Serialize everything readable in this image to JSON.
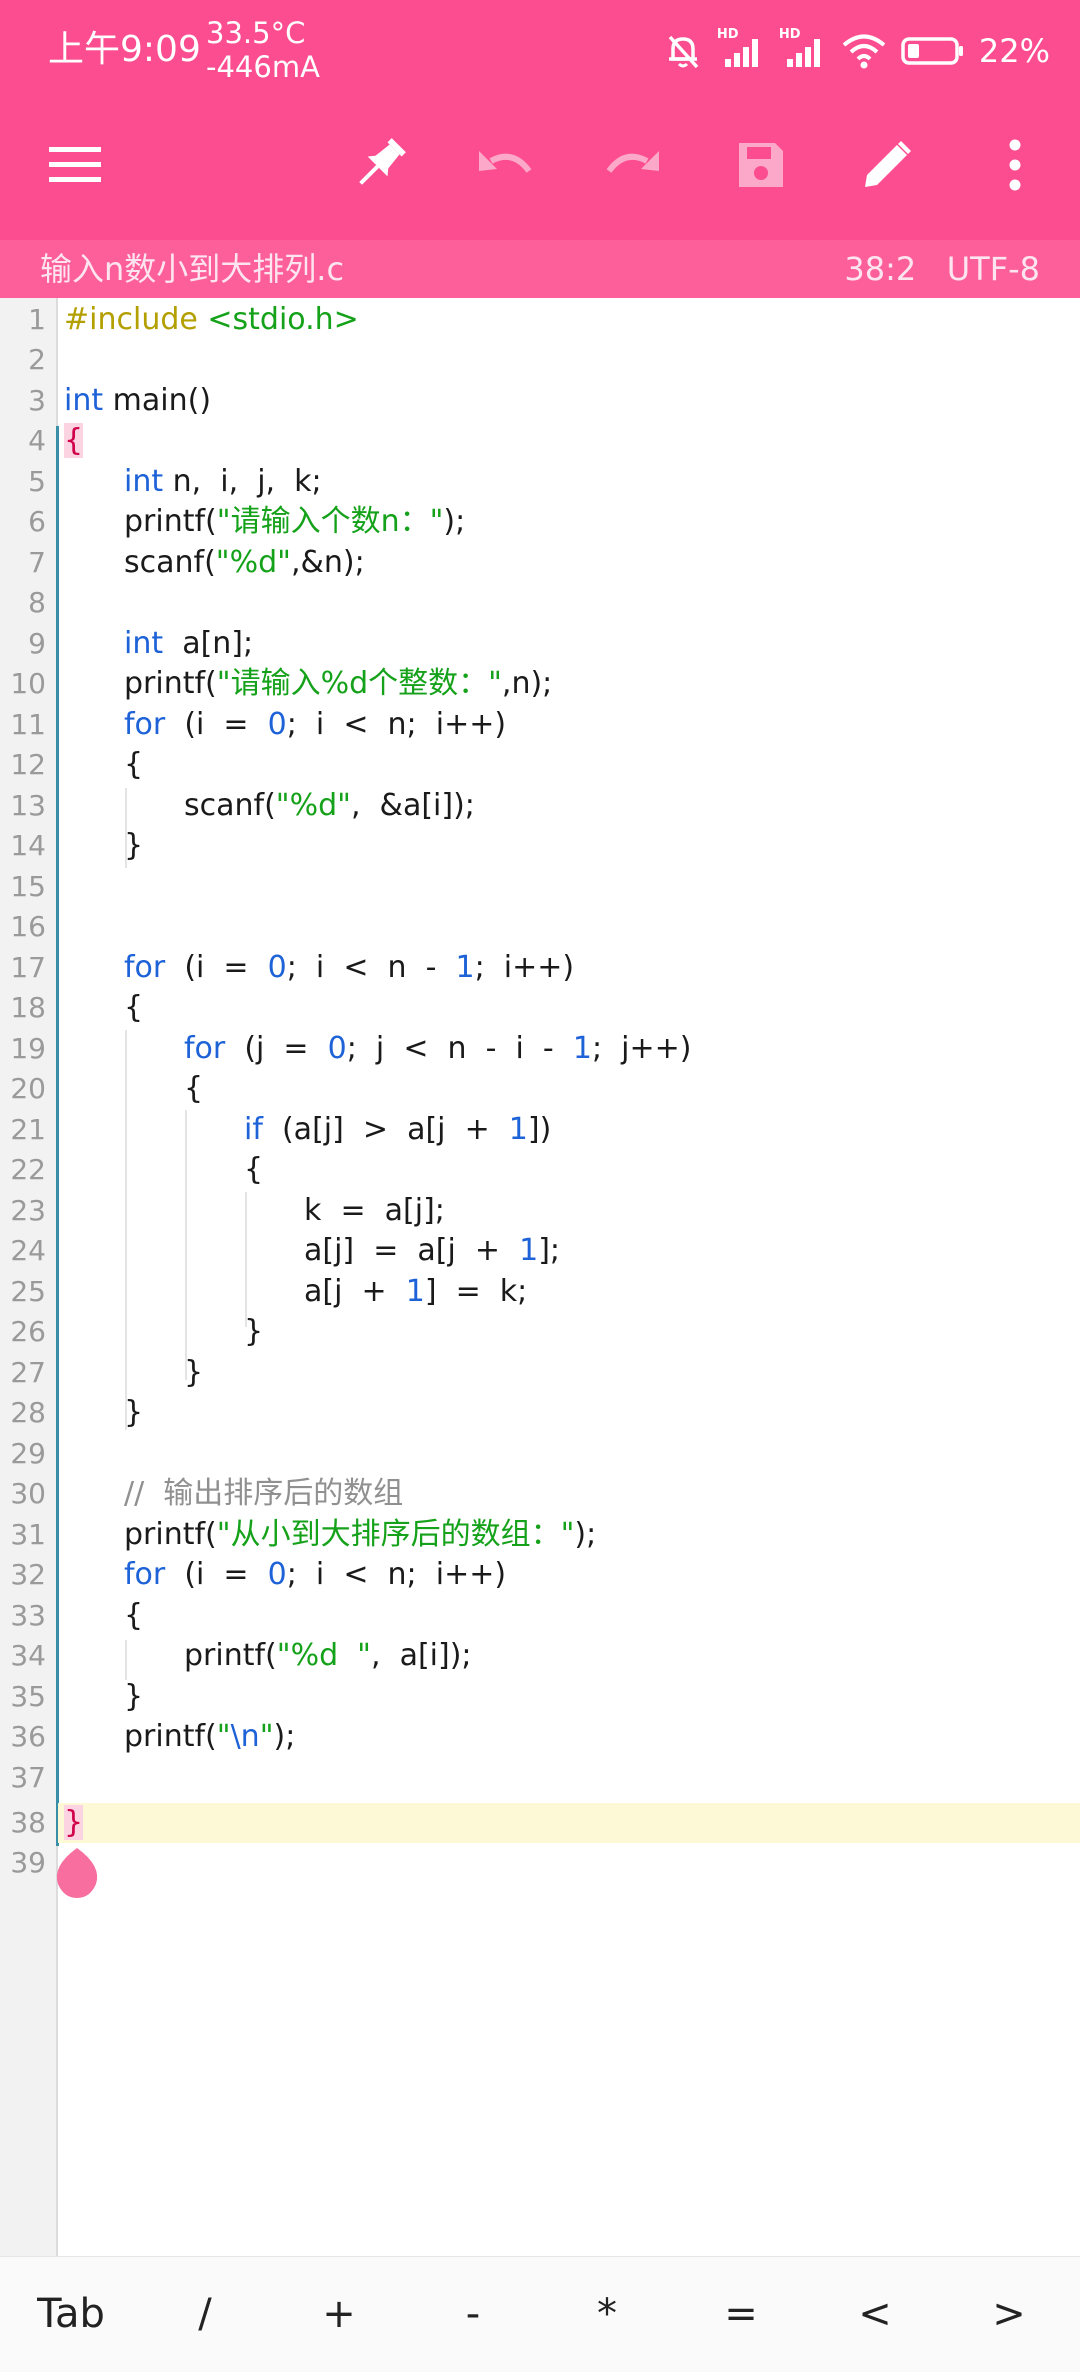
{
  "status_bar": {
    "time": "上午9:09",
    "temperature": "33.5°C",
    "current": "-446mA",
    "hd1": "HD",
    "hd2": "HD",
    "battery_percent": "22%"
  },
  "toolbar": {
    "icons": [
      "menu-icon",
      "pin-icon",
      "undo-icon",
      "redo-icon",
      "save-icon",
      "edit-icon",
      "more-icon"
    ],
    "accent": "#fb4d8f"
  },
  "file": {
    "name": "输入n数小到大排列.c",
    "cursor": "38:2",
    "encoding": "UTF-8"
  },
  "editor": {
    "line_numbers": [
      "1",
      "2",
      "3",
      "4",
      "5",
      "6",
      "7",
      "8",
      "9",
      "10",
      "11",
      "12",
      "13",
      "14",
      "15",
      "16",
      "17",
      "18",
      "19",
      "20",
      "21",
      "22",
      "23",
      "24",
      "25",
      "26",
      "27",
      "28",
      "29",
      "30",
      "31",
      "32",
      "33",
      "34",
      "35",
      "36",
      "37",
      "38",
      "39"
    ],
    "lines": [
      [
        "#include",
        " ",
        "<stdio.h>"
      ],
      [],
      [
        "int",
        " main()"
      ],
      [
        "{"
      ],
      [
        "int",
        " n,  i,  j,  k;"
      ],
      [
        "printf(",
        "\"请输入个数n：\"",
        ");"
      ],
      [
        "scanf(",
        "\"%d\"",
        ",&n);"
      ],
      [],
      [
        "int",
        "  a[n];"
      ],
      [
        "printf(",
        "\"请输入%d个整数：\"",
        ",n);"
      ],
      [
        "for",
        "  (i  =  ",
        "0",
        ";  i  <  n;  i++)"
      ],
      [
        "{"
      ],
      [
        "scanf(",
        "\"%d\"",
        ",  &a[i]);"
      ],
      [
        "}"
      ],
      [],
      [],
      [
        "for",
        "  (i  =  ",
        "0",
        ";  i  <  n  -  ",
        "1",
        ";  i++)"
      ],
      [
        "{"
      ],
      [
        "for",
        "  (j  =  ",
        "0",
        ";  j  <  n  -  i  -  ",
        "1",
        ";  j++)"
      ],
      [
        "{"
      ],
      [
        "if",
        "  (a[j]  >  a[j  +  ",
        "1",
        "])"
      ],
      [
        "{"
      ],
      [
        "k  =  a[j];"
      ],
      [
        "a[j]  =  a[j  +  ",
        "1",
        "];"
      ],
      [
        "a[j  +  ",
        "1",
        "]  =  k;"
      ],
      [
        "}"
      ],
      [
        "}"
      ],
      [
        "}"
      ],
      [],
      [
        "//  输出排序后的数组"
      ],
      [
        "printf(",
        "\"从小到大排序后的数组：\"",
        ");"
      ],
      [
        "for",
        "  (i  =  ",
        "0",
        ";  i  <  n;  i++)"
      ],
      [
        "{"
      ],
      [
        "printf(",
        "\"%d  \"",
        ",  a[i]);"
      ],
      [
        "}"
      ],
      [
        "printf(",
        "\"",
        "\\n",
        "\"",
        ");"
      ],
      [],
      [
        "}"
      ],
      []
    ]
  },
  "keys": [
    "Tab",
    "/",
    "+",
    "-",
    "*",
    "=",
    "<",
    ">"
  ]
}
